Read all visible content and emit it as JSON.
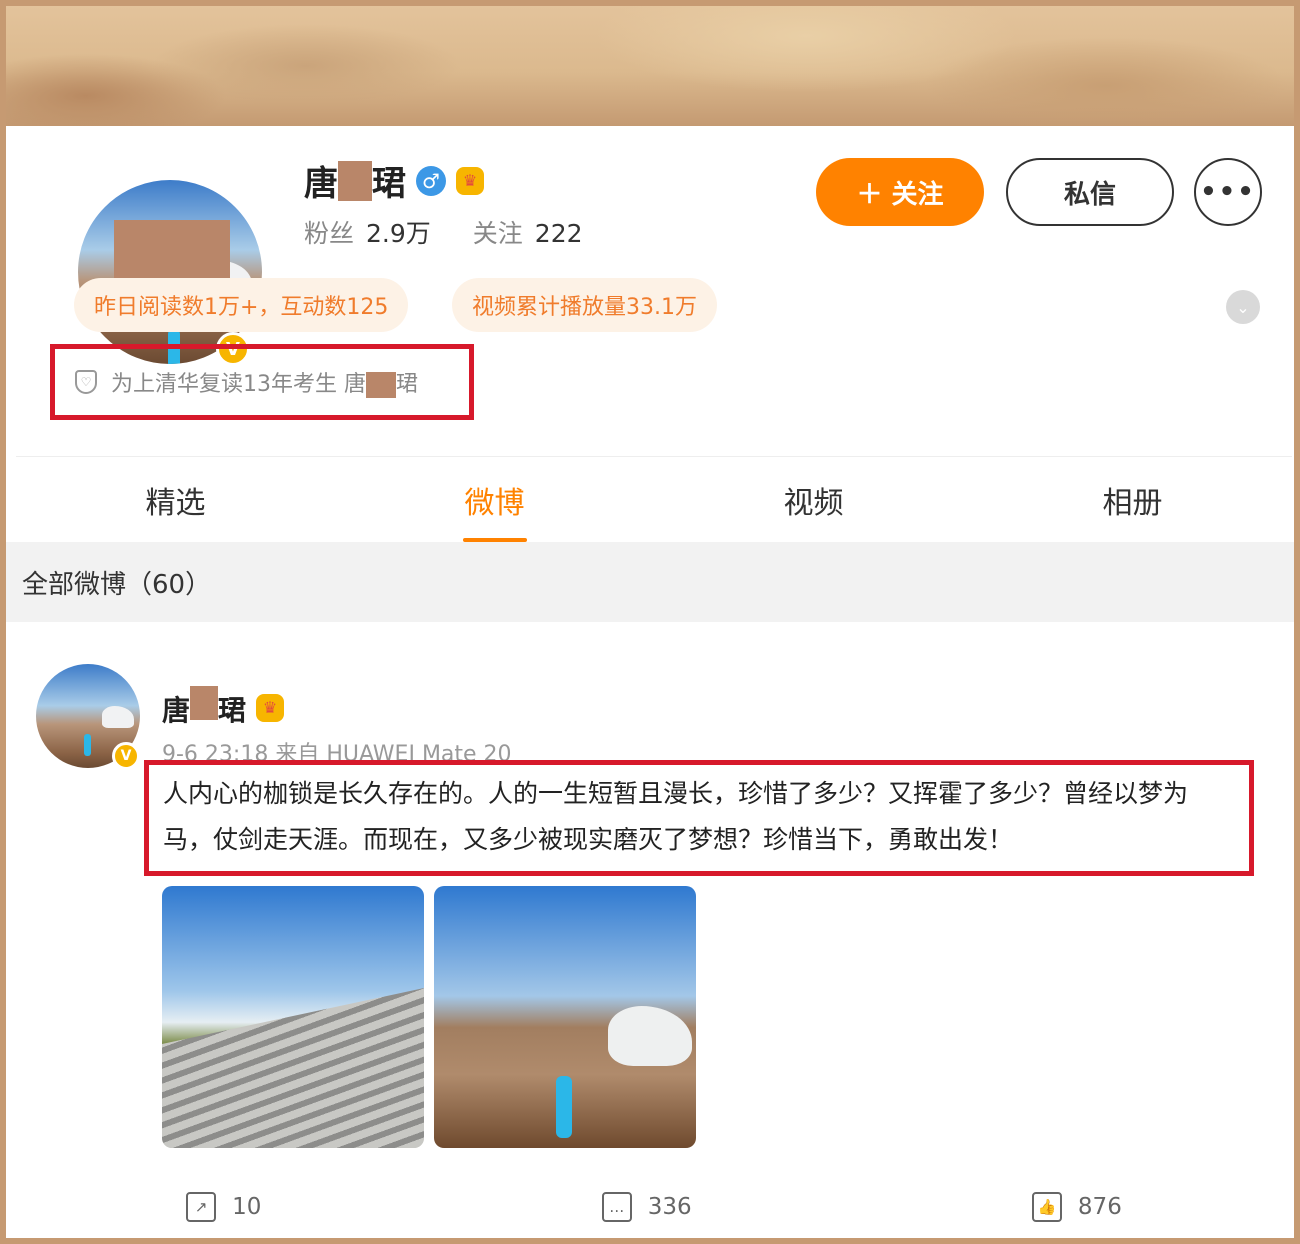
{
  "profile": {
    "name_left": "唐",
    "name_right": "珺",
    "gender_symbol": "♂",
    "vip_icon": "crown-vip-icon",
    "verified": "V",
    "fans_label": "粉丝",
    "fans_value": "2.9万",
    "following_label": "关注",
    "following_value": "222",
    "follow_button": "＋ 关注",
    "message_button": "私信",
    "more_button": "•••",
    "tags": [
      "昨日阅读数1万+，互动数125",
      "视频累计播放量33.1万"
    ],
    "description_prefix": "为上清华复读13年考生 唐",
    "description_suffix": "珺",
    "expand_icon": "⌄"
  },
  "tabs": [
    "精选",
    "微博",
    "视频",
    "相册"
  ],
  "active_tab": "微博",
  "section": {
    "title": "全部微博（60）"
  },
  "post": {
    "name_left": "唐",
    "name_right": "珺",
    "meta": "9-6 23:18 来自 HUAWEI Mate 20",
    "text": "人内心的枷锁是长久存在的。人的一生短暂且漫长，珍惜了多少？又挥霍了多少？曾经以梦为马，仗剑走天涯。而现在，又多少被现实磨灭了梦想？珍惜当下，勇敢出发！",
    "repost_count": "10",
    "comment_count": "336",
    "like_count": "876"
  },
  "colors": {
    "accent": "#ff8200",
    "highlight_box": "#d7192b",
    "verified_badge": "#f7b500",
    "tag_bg": "#fdf2e6"
  }
}
